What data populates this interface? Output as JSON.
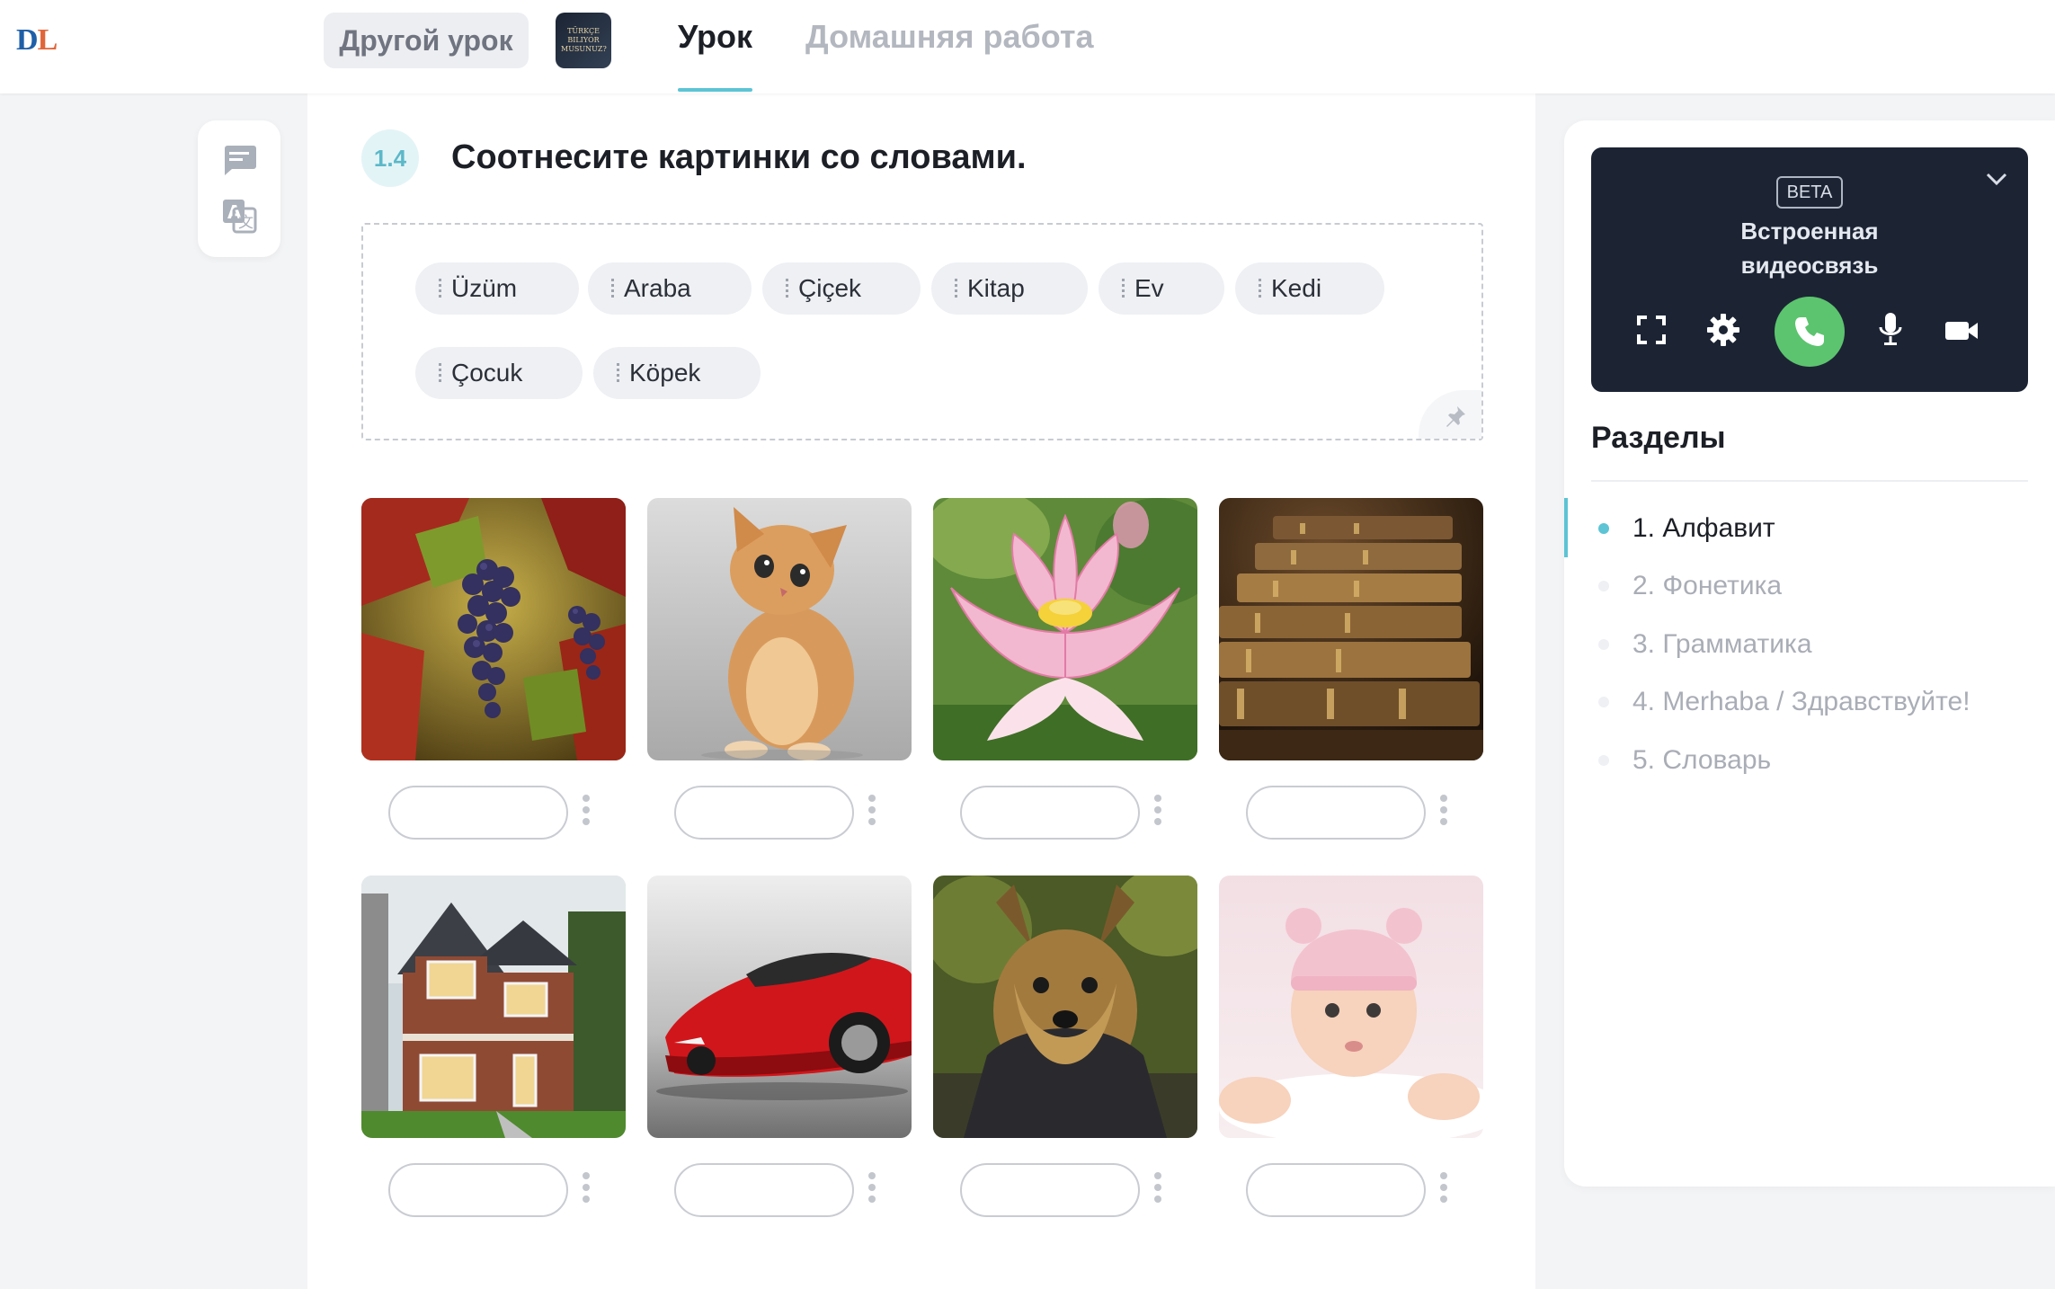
{
  "app": {
    "logo_part1": "D",
    "logo_part2": "L"
  },
  "header": {
    "other_lesson": "Другой урок",
    "course_thumb_text": "TÜRKÇE BILIYOR MUSUNUZ?",
    "tabs": [
      {
        "label": "Урок",
        "active": true
      },
      {
        "label": "Домашняя работа",
        "active": false
      }
    ]
  },
  "tools": {
    "note_icon": "note-icon",
    "translate_icon": "translate-icon"
  },
  "task": {
    "number": "1.4",
    "title": "Соотнесите картинки со словами."
  },
  "word_bank": {
    "words": [
      "Üzüm",
      "Araba",
      "Çiçek",
      "Kitap",
      "Ev",
      "Kedi",
      "Çocuk",
      "Köpek"
    ],
    "pin_icon": "pin-icon"
  },
  "pictures": [
    {
      "subject": "grapes",
      "answer": ""
    },
    {
      "subject": "kitten",
      "answer": ""
    },
    {
      "subject": "lotus-flower",
      "answer": ""
    },
    {
      "subject": "books",
      "answer": ""
    },
    {
      "subject": "house",
      "answer": ""
    },
    {
      "subject": "red-car",
      "answer": ""
    },
    {
      "subject": "yorkshire-terrier",
      "answer": ""
    },
    {
      "subject": "baby",
      "answer": ""
    }
  ],
  "video": {
    "badge": "BETA",
    "title_line1": "Встроенная",
    "title_line2": "видеосвязь",
    "controls": [
      "fullscreen-icon",
      "gear-icon",
      "phone-icon",
      "microphone-icon",
      "camera-icon"
    ]
  },
  "sections": {
    "title": "Разделы",
    "items": [
      {
        "label": "1. Алфавит",
        "active": true
      },
      {
        "label": "2. Фонетика",
        "active": false
      },
      {
        "label": "3. Грамматика",
        "active": false
      },
      {
        "label": "4. Merhaba / Здравствуйте!",
        "active": false
      },
      {
        "label": "5. Словарь",
        "active": false
      }
    ]
  },
  "colors": {
    "accent": "#5cc4d4",
    "call_green": "#5cc46e",
    "video_bg": "#1c2434",
    "chip_bg": "#eef0f3"
  }
}
